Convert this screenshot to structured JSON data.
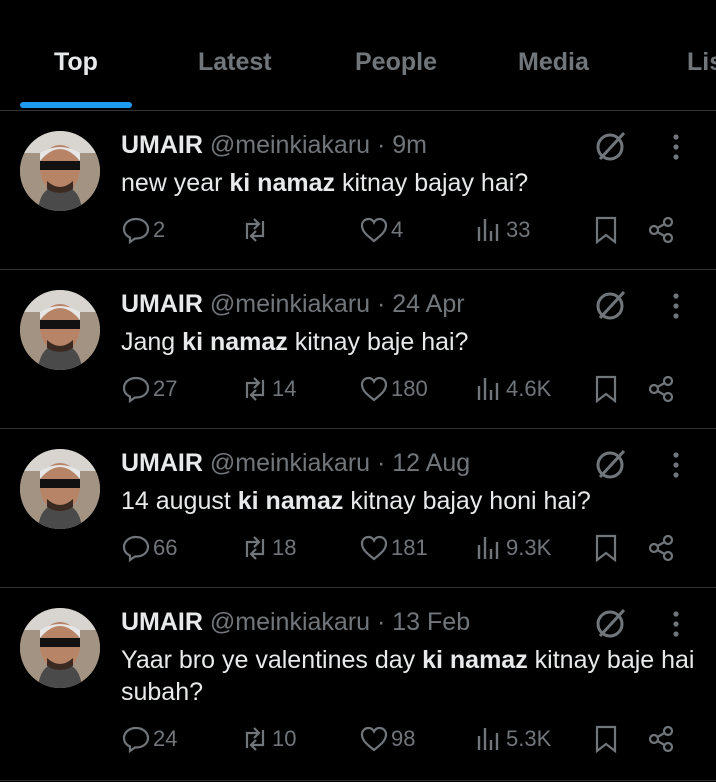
{
  "tabs": [
    {
      "label": "Top"
    },
    {
      "label": "Latest"
    },
    {
      "label": "People"
    },
    {
      "label": "Media"
    },
    {
      "label": "Lis"
    }
  ],
  "tweets": [
    {
      "name": "UMAIR",
      "handle": "@meinkiakaru",
      "dot": "·",
      "time": "9m",
      "text_pre": "new year ",
      "text_bold": "ki namaz",
      "text_post": " kitnay bajay hai?",
      "replies": "2",
      "reposts": "",
      "likes": "4",
      "views": "33"
    },
    {
      "name": "UMAIR",
      "handle": "@meinkiakaru",
      "dot": "·",
      "time": "24 Apr",
      "text_pre": "Jang ",
      "text_bold": "ki namaz",
      "text_post": " kitnay baje hai?",
      "replies": "27",
      "reposts": "14",
      "likes": "180",
      "views": "4.6K"
    },
    {
      "name": "UMAIR",
      "handle": "@meinkiakaru",
      "dot": "·",
      "time": "12 Aug",
      "text_pre": "14 august ",
      "text_bold": "ki namaz",
      "text_post": " kitnay bajay honi hai?",
      "replies": "66",
      "reposts": "18",
      "likes": "181",
      "views": "9.3K"
    },
    {
      "name": "UMAIR",
      "handle": "@meinkiakaru",
      "dot": "·",
      "time": "13 Feb",
      "text_pre": "Yaar bro ye valentines day ",
      "text_bold": "ki namaz",
      "text_post": " kitnay baje hai subah?",
      "replies": "24",
      "reposts": "10",
      "likes": "98",
      "views": "5.3K"
    }
  ],
  "icons": {
    "reply": "reply-icon",
    "repost": "repost-icon",
    "like": "heart-icon",
    "views": "views-icon",
    "bookmark": "bookmark-icon",
    "share": "share-icon",
    "grok": "grok-icon",
    "more": "more-icon"
  },
  "colors": {
    "accent": "#1d9bf0",
    "background": "#000000",
    "muted": "#71767b",
    "text": "#e7e9ea",
    "divider": "#2f3336"
  }
}
